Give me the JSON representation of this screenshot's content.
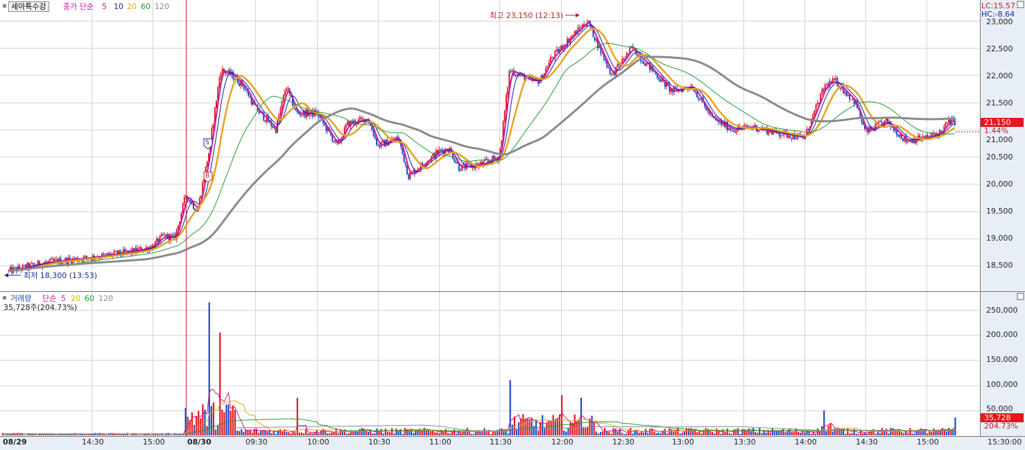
{
  "price_panel": {
    "title": "세아특수강",
    "legend_prefix": "종가 단순",
    "ma_labels": [
      "5",
      "10",
      "20",
      "60",
      "120"
    ],
    "ma_colors": [
      "#c8189a",
      "#1a1a9a",
      "#e8a21a",
      "#209a30",
      "#8a8a8a"
    ],
    "lc_label": "LC:15.57",
    "hc_label": "HC:-8.64",
    "high_annotation": "최고 23,150 (12:13)",
    "low_annotation": "최저 18,300 (13:53)",
    "current_price": "21,150",
    "current_change": "1.44%",
    "marker_s": "S",
    "marker_b": "B",
    "yticks": [
      "23,000",
      "22,500",
      "22,000",
      "21,500",
      "21,000",
      "20,500",
      "20,000",
      "19,500",
      "19,000",
      "18,500"
    ]
  },
  "volume_panel": {
    "legend_title": "거래량",
    "legend_prefix": "단순",
    "ma_labels": [
      "5",
      "20",
      "60",
      "120"
    ],
    "current_line": "35,728주(204.73%)",
    "current_volume": "35,728",
    "current_ratio": "204.73%",
    "yticks": [
      "250,000",
      "200,000",
      "150,000",
      "100,000",
      "50,000"
    ]
  },
  "x_axis": {
    "labels": [
      "08/29",
      "14:30",
      "15:00",
      "08/30",
      "09:30",
      "10:00",
      "10:30",
      "11:00",
      "11:30",
      "12:00",
      "12:30",
      "13:00",
      "13:30",
      "14:00",
      "14:30",
      "15:00",
      "15:30:00"
    ]
  },
  "colors": {
    "up": "#e8141e",
    "down": "#1a4ac8",
    "grid": "#d4d4d4",
    "axis_bg": "#e8eef6",
    "current_bg": "#e8141e"
  },
  "chart_data": {
    "type": "candlestick",
    "title": "세아특수강",
    "price_ylim": [
      18250,
      23250
    ],
    "volume_ylim": [
      0,
      270000
    ],
    "session_boundary": "08/30",
    "price_series": [
      {
        "time": "08/29 13:55",
        "close": 18400
      },
      {
        "time": "08/29 14:10",
        "close": 18550
      },
      {
        "time": "08/29 14:30",
        "close": 18650
      },
      {
        "time": "08/29 14:50",
        "close": 18750
      },
      {
        "time": "08/29 15:00",
        "close": 18850
      },
      {
        "time": "08/29 15:10",
        "close": 19050
      },
      {
        "time": "08/29 15:20",
        "close": 19000
      },
      {
        "time": "08/30 09:00",
        "close": 19800
      },
      {
        "time": "08/30 09:05",
        "close": 19500
      },
      {
        "time": "08/30 09:10",
        "close": 20600
      },
      {
        "time": "08/30 09:15",
        "close": 22100
      },
      {
        "time": "08/30 09:20",
        "close": 22000
      },
      {
        "time": "08/30 09:25",
        "close": 21800
      },
      {
        "time": "08/30 09:30",
        "close": 21400
      },
      {
        "time": "08/30 09:40",
        "close": 21000
      },
      {
        "time": "08/30 09:45",
        "close": 21800
      },
      {
        "time": "08/30 09:50",
        "close": 21300
      },
      {
        "time": "08/30 10:00",
        "close": 21300
      },
      {
        "time": "08/30 10:10",
        "close": 20700
      },
      {
        "time": "08/30 10:15",
        "close": 21100
      },
      {
        "time": "08/30 10:25",
        "close": 21200
      },
      {
        "time": "08/30 10:30",
        "close": 20700
      },
      {
        "time": "08/30 10:40",
        "close": 20850
      },
      {
        "time": "08/30 10:45",
        "close": 20150
      },
      {
        "time": "08/30 10:55",
        "close": 20450
      },
      {
        "time": "08/30 11:00",
        "close": 20600
      },
      {
        "time": "08/30 11:05",
        "close": 20650
      },
      {
        "time": "08/30 11:10",
        "close": 20300
      },
      {
        "time": "08/30 11:20",
        "close": 20350
      },
      {
        "time": "08/30 11:30",
        "close": 20500
      },
      {
        "time": "08/30 11:35",
        "close": 22100
      },
      {
        "time": "08/30 11:45",
        "close": 21900
      },
      {
        "time": "08/30 11:50",
        "close": 21900
      },
      {
        "time": "08/30 11:55",
        "close": 22300
      },
      {
        "time": "08/30 12:05",
        "close": 22700
      },
      {
        "time": "08/30 12:13",
        "close": 23000
      },
      {
        "time": "08/30 12:20",
        "close": 22400
      },
      {
        "time": "08/30 12:25",
        "close": 22000
      },
      {
        "time": "08/30 12:35",
        "close": 22500
      },
      {
        "time": "08/30 12:45",
        "close": 22100
      },
      {
        "time": "08/30 12:55",
        "close": 21700
      },
      {
        "time": "08/30 13:05",
        "close": 21800
      },
      {
        "time": "08/30 13:15",
        "close": 21200
      },
      {
        "time": "08/30 13:25",
        "close": 21000
      },
      {
        "time": "08/30 13:35",
        "close": 21050
      },
      {
        "time": "08/30 13:45",
        "close": 20950
      },
      {
        "time": "08/30 14:00",
        "close": 20850
      },
      {
        "time": "08/30 14:10",
        "close": 21800
      },
      {
        "time": "08/30 14:15",
        "close": 21900
      },
      {
        "time": "08/30 14:25",
        "close": 21500
      },
      {
        "time": "08/30 14:30",
        "close": 20950
      },
      {
        "time": "08/30 14:40",
        "close": 21150
      },
      {
        "time": "08/30 14:50",
        "close": 20800
      },
      {
        "time": "08/30 15:00",
        "close": 20850
      },
      {
        "time": "08/30 15:10",
        "close": 20950
      },
      {
        "time": "08/30 15:15",
        "close": 21150
      },
      {
        "time": "08/30 15:20",
        "close": 21150
      }
    ],
    "volume_series": [
      {
        "time": "08/30 09:00",
        "volume": 55000
      },
      {
        "time": "08/30 09:10",
        "volume": 265000
      },
      {
        "time": "08/30 09:15",
        "volume": 205000
      },
      {
        "time": "08/30 09:20",
        "volume": 60000
      },
      {
        "time": "08/30 09:50",
        "volume": 75000
      },
      {
        "time": "08/30 11:35",
        "volume": 110000
      },
      {
        "time": "08/30 12:00",
        "volume": 80000
      },
      {
        "time": "08/30 12:10",
        "volume": 75000
      },
      {
        "time": "08/30 14:10",
        "volume": 50000
      },
      {
        "time": "08/30 15:20",
        "volume": 35728
      }
    ]
  }
}
